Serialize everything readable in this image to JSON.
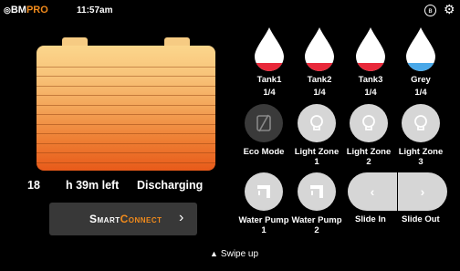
{
  "header": {
    "logo_bm": "BM",
    "logo_pro": "PRO",
    "time": "11:57am",
    "bluetooth_glyph": "ʙ",
    "settings_glyph": "⚙"
  },
  "battery": {
    "fill_fraction": 1.0,
    "gradient_top": "#fbd68c",
    "gradient_bottom": "#e85a1a"
  },
  "status": {
    "value": "18",
    "time_left": "h 39m left",
    "state": "Discharging"
  },
  "smartconnect": {
    "label_a": "Smart",
    "label_b": "Connect",
    "chevron": "›"
  },
  "swipe": {
    "caret": "▲",
    "label": "Swipe up"
  },
  "tanks": [
    {
      "name": "Tank1",
      "level": "1/4",
      "color": "#e8283a"
    },
    {
      "name": "Tank2",
      "level": "1/4",
      "color": "#e8283a"
    },
    {
      "name": "Tank3",
      "level": "1/4",
      "color": "#e8283a"
    },
    {
      "name": "Grey",
      "level": "1/4",
      "color": "#4aa8e8"
    }
  ],
  "controls": {
    "eco_mode": "Eco Mode",
    "light_zone_1": "Light Zone 1",
    "light_zone_2": "Light Zone 2",
    "light_zone_3": "Light Zone 3",
    "water_pump_1": "Water Pump 1",
    "water_pump_2": "Water Pump 2",
    "slide_in": "Slide In",
    "slide_out": "Slide Out",
    "slide_in_glyph": "‹",
    "slide_out_glyph": "›"
  },
  "colors": {
    "accent": "#f08a1c",
    "button_light": "#d6d6d6",
    "button_dark": "#3a3a3a"
  }
}
